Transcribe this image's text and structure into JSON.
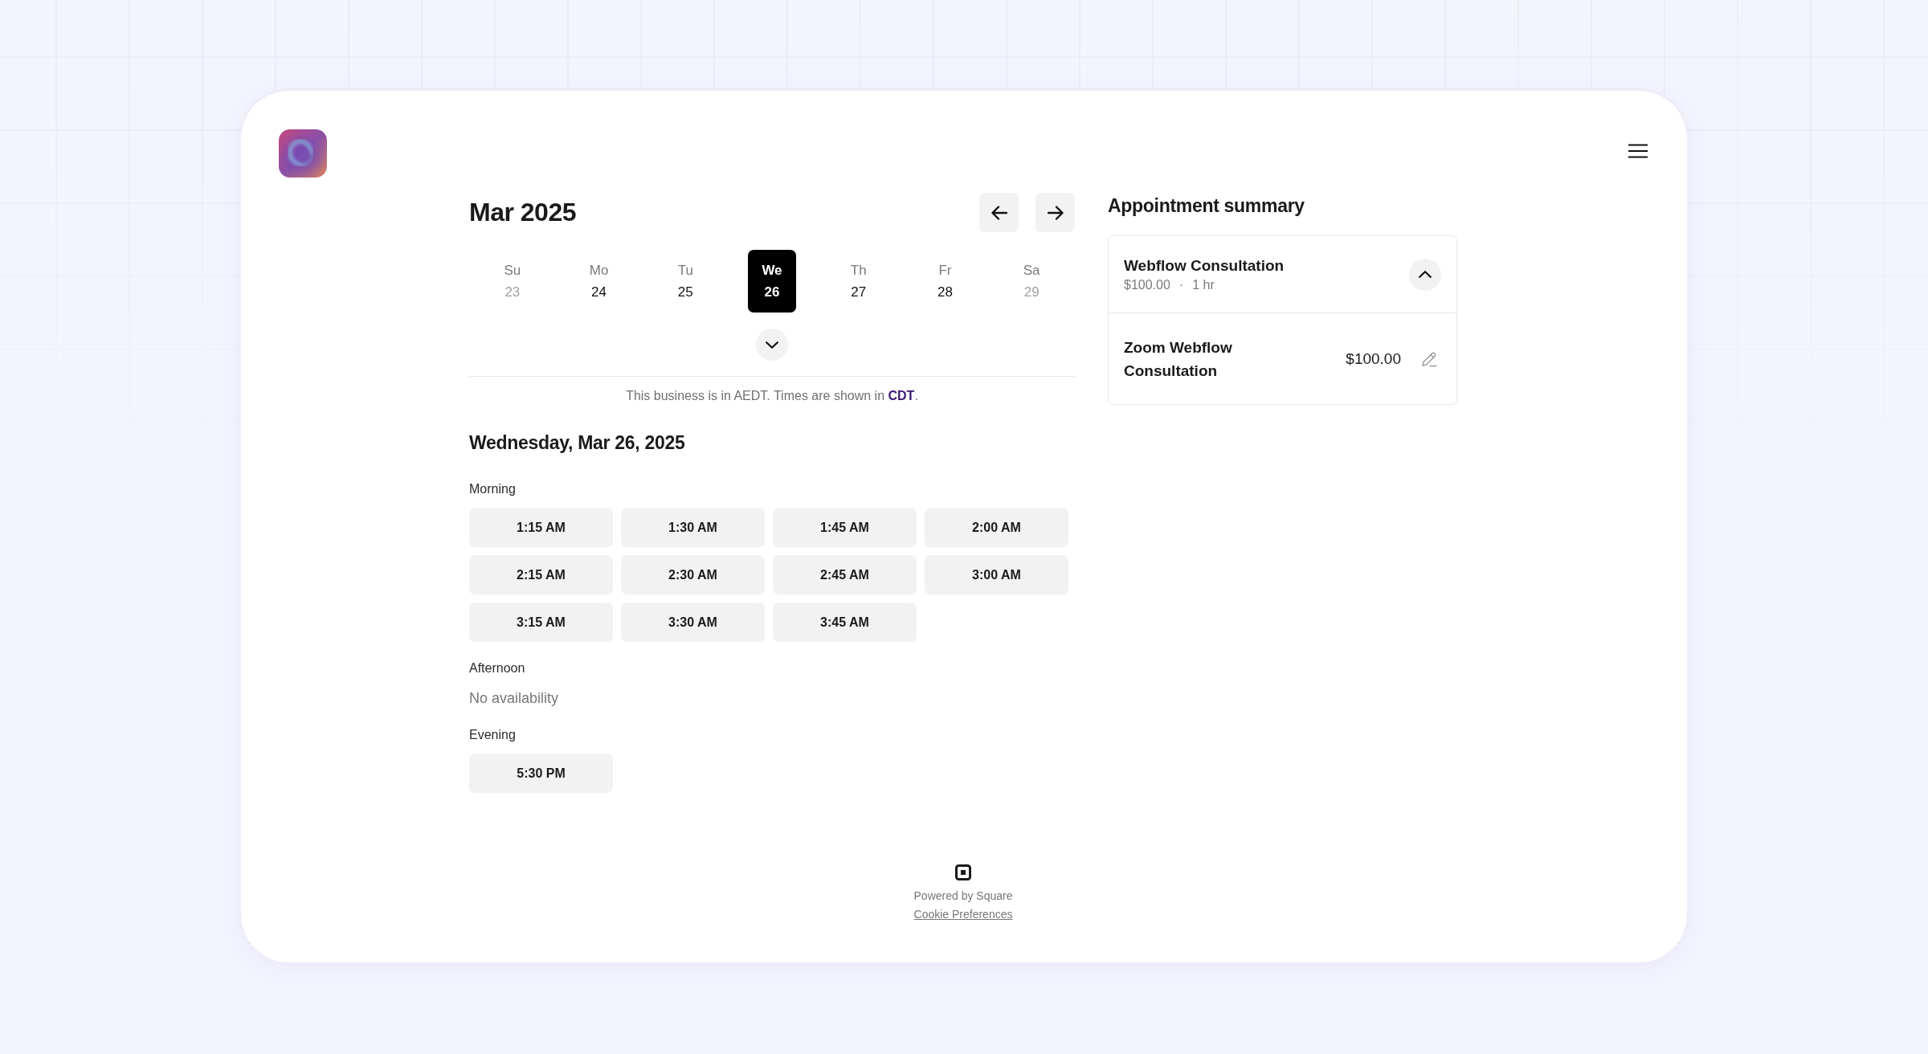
{
  "calendar": {
    "month": "Mar 2025",
    "expanded": false,
    "days": [
      {
        "weekday": "Su",
        "date": "23",
        "selected": false,
        "disabled": true
      },
      {
        "weekday": "Mo",
        "date": "24",
        "selected": false,
        "disabled": false
      },
      {
        "weekday": "Tu",
        "date": "25",
        "selected": false,
        "disabled": false
      },
      {
        "weekday": "We",
        "date": "26",
        "selected": true,
        "disabled": false
      },
      {
        "weekday": "Th",
        "date": "27",
        "selected": false,
        "disabled": false
      },
      {
        "weekday": "Fr",
        "date": "28",
        "selected": false,
        "disabled": false
      },
      {
        "weekday": "Sa",
        "date": "29",
        "selected": false,
        "disabled": true
      }
    ],
    "timezone_note": {
      "before": "This business is in AEDT. Times are shown in ",
      "link": "CDT",
      "after": "."
    }
  },
  "schedule": {
    "date": "Wednesday, Mar 26, 2025",
    "periods": [
      {
        "label": "Morning",
        "slots": [
          "1:15 AM",
          "1:30 AM",
          "1:45 AM",
          "2:00 AM",
          "2:15 AM",
          "2:30 AM",
          "2:45 AM",
          "3:00 AM",
          "3:15 AM",
          "3:30 AM",
          "3:45 AM"
        ]
      },
      {
        "label": "Afternoon",
        "message": "No availability"
      },
      {
        "label": "Evening",
        "slots": [
          "5:30 PM"
        ]
      }
    ]
  },
  "summary": {
    "title": "Appointment summary",
    "service": {
      "name": "Webflow Consultation",
      "price": "$100.00",
      "separator": "·",
      "duration": "1 hr",
      "expanded": true
    },
    "items": [
      {
        "name": "Zoom Webflow Consultation",
        "price": "$100.00"
      }
    ]
  },
  "footer": {
    "powered_by": "Powered by Square",
    "link": "Cookie Preferences"
  }
}
